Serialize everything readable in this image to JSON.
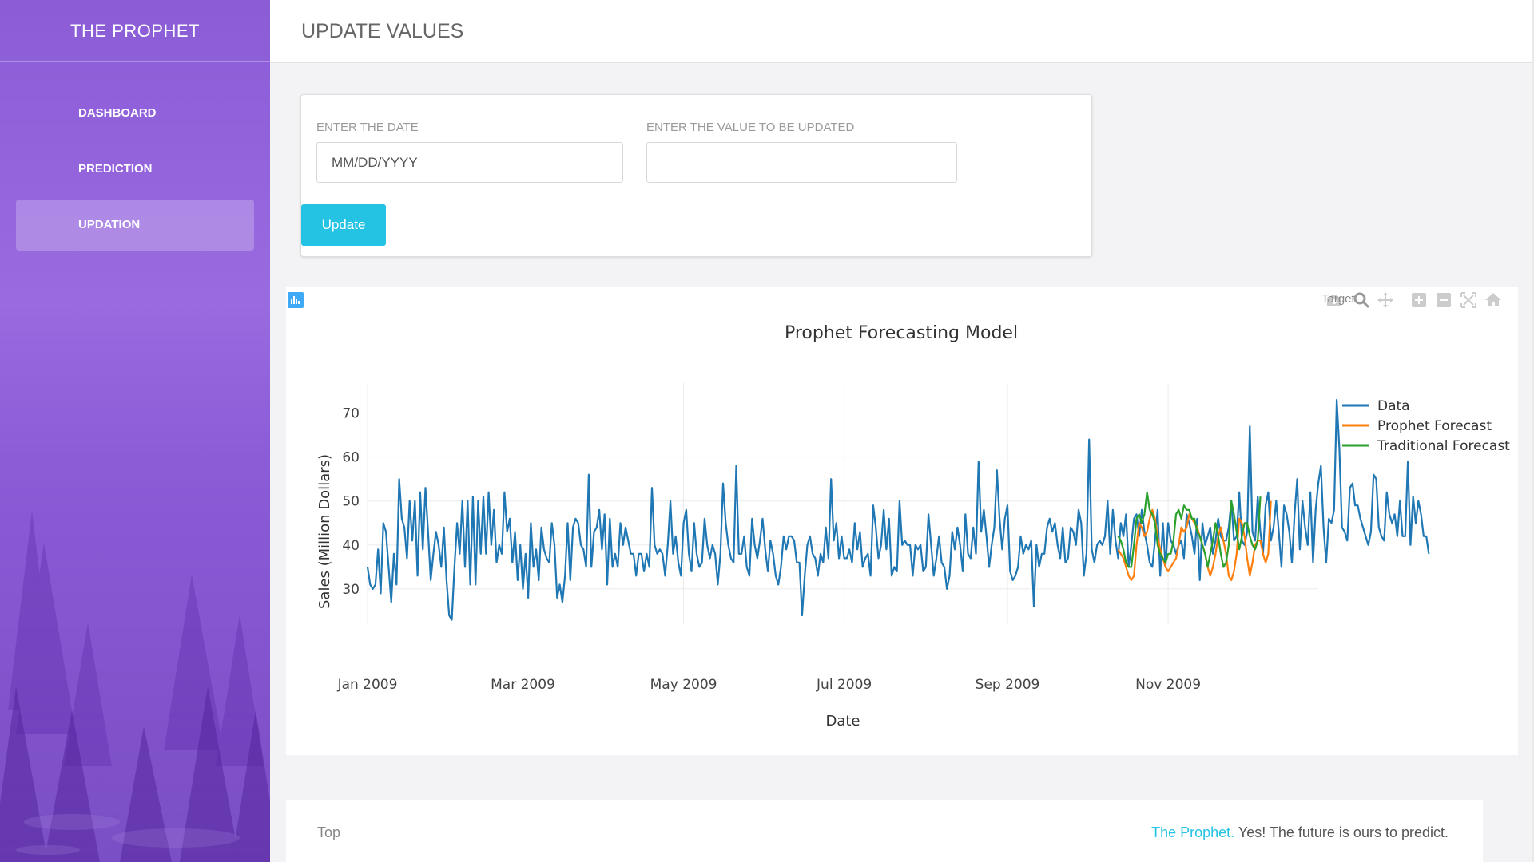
{
  "sidebar": {
    "brand": "THE PROPHET",
    "items": [
      {
        "label": "DASHBOARD",
        "active": false
      },
      {
        "label": "PREDICTION",
        "active": false
      },
      {
        "label": "UPDATION",
        "active": true
      }
    ]
  },
  "header": {
    "title": "UPDATE VALUES"
  },
  "form": {
    "date_label": "ENTER THE DATE",
    "date_placeholder": "MM/DD/YYYY",
    "value_label": "ENTER THE VALUE TO BE UPDATED",
    "value_value": "",
    "update_label": "Update"
  },
  "modebar": {
    "overlay_text": "Target",
    "icons": [
      "camera-icon",
      "zoom-icon",
      "pan-icon",
      "zoom-in-icon",
      "zoom-out-icon",
      "autoscale-icon",
      "home-icon",
      "spike-lines-icon",
      "hover-closest-icon",
      "hover-compare-icon",
      "plotly-logo-icon"
    ]
  },
  "chart_data": {
    "type": "line",
    "title": "Prophet Forecasting Model",
    "xlabel": "Date",
    "ylabel": "Sales (Million Dollars)",
    "x_ticks": [
      "Jan 2009",
      "Mar 2009",
      "May 2009",
      "Jul 2009",
      "Sep 2009",
      "Nov 2009"
    ],
    "x_tick_dates": [
      "2009-01-01",
      "2009-03-01",
      "2009-05-01",
      "2009-07-01",
      "2009-09-01",
      "2009-11-01"
    ],
    "y_ticks": [
      30,
      40,
      50,
      60,
      70
    ],
    "ylim": [
      22,
      75
    ],
    "xlim": [
      "2009-01-01",
      "2009-12-28"
    ],
    "grid": true,
    "legend_position": "top-right",
    "series": [
      {
        "name": "Data",
        "color": "#1f77b4",
        "start": "2009-01-01",
        "values": [
          35,
          31,
          30,
          31,
          39,
          29,
          45,
          43,
          35,
          27,
          38,
          31,
          55,
          46,
          44,
          37,
          50,
          41,
          50,
          33,
          52,
          39,
          53,
          43,
          32,
          38,
          43,
          40,
          35,
          44,
          32,
          24,
          23,
          35,
          45,
          38,
          50,
          35,
          50,
          31,
          51,
          31,
          50,
          38,
          51,
          38,
          52,
          40,
          48,
          36,
          40,
          38,
          52,
          43,
          46,
          36,
          43,
          32,
          40,
          30,
          38,
          28,
          45,
          35,
          39,
          32,
          44,
          39,
          37,
          36,
          45,
          40,
          28,
          31,
          27,
          33,
          45,
          32,
          44,
          46,
          45,
          40,
          39,
          35,
          56,
          35,
          43,
          44,
          48,
          39,
          47,
          31,
          46,
          35,
          38,
          35,
          45,
          40,
          44,
          41,
          38,
          38,
          33,
          38,
          38,
          34,
          38,
          35,
          53,
          40,
          38,
          39,
          38,
          33,
          40,
          50,
          38,
          42,
          36,
          33,
          45,
          48,
          38,
          34,
          45,
          38,
          35,
          36,
          46,
          40,
          37,
          40,
          38,
          31,
          38,
          54,
          45,
          40,
          37,
          36,
          58,
          38,
          38,
          42,
          35,
          33,
          46,
          40,
          37,
          41,
          46,
          39,
          34,
          41,
          38,
          33,
          31,
          35,
          42,
          39,
          42,
          42,
          41,
          36,
          36,
          24,
          33,
          40,
          42,
          38,
          37,
          33,
          38,
          36,
          44,
          37,
          55,
          41,
          45,
          37,
          42,
          37,
          37,
          39,
          36,
          45,
          39,
          43,
          35,
          37,
          38,
          33,
          49,
          44,
          37,
          40,
          48,
          39,
          46,
          33,
          35,
          34,
          50,
          40,
          41,
          40,
          40,
          33,
          40,
          39,
          40,
          34,
          35,
          47,
          40,
          33,
          37,
          42,
          36,
          35,
          30,
          33,
          43,
          39,
          44,
          40,
          34,
          47,
          38,
          37,
          44,
          38,
          59,
          43,
          48,
          42,
          35,
          40,
          44,
          57,
          46,
          39,
          46,
          49,
          34,
          32,
          33,
          35,
          42,
          38,
          40,
          39,
          41,
          26,
          40,
          35,
          38,
          38,
          44,
          46,
          43,
          45,
          40,
          37,
          44,
          36,
          37,
          44,
          43,
          40,
          48,
          45,
          33,
          38,
          64,
          39,
          36,
          40,
          41,
          40,
          42,
          50,
          38,
          48,
          41,
          37,
          45,
          42,
          47,
          35,
          40,
          46,
          47,
          42,
          48,
          43,
          40,
          36,
          35,
          41,
          48,
          33,
          45,
          35,
          45,
          41,
          40,
          38,
          40,
          41,
          37,
          47,
          45,
          42,
          38,
          46,
          32,
          45,
          40,
          42,
          44,
          38,
          41,
          46,
          42,
          41,
          41,
          44,
          50,
          41,
          42,
          52,
          41,
          40,
          43,
          67,
          43,
          41,
          51,
          43,
          38,
          49,
          52,
          41,
          44,
          50,
          43,
          35,
          49,
          47,
          43,
          36,
          47,
          55,
          39,
          50,
          44,
          40,
          52,
          36,
          48,
          54,
          58,
          44,
          36,
          46,
          45,
          48,
          73,
          62,
          44,
          43,
          41,
          53,
          54,
          49,
          49,
          46,
          44,
          42,
          40,
          43,
          56,
          55,
          44,
          42,
          41,
          52,
          47,
          45,
          47,
          42,
          50,
          42,
          42,
          59,
          40,
          51,
          45,
          50,
          47,
          42,
          42,
          38
        ]
      },
      {
        "name": "Prophet Forecast",
        "color": "#ff7f0e",
        "start": "2009-10-13",
        "values": [
          39,
          38,
          37,
          35,
          33,
          32,
          33,
          40,
          45,
          44,
          42,
          43,
          46,
          48,
          46,
          42,
          39,
          37,
          35,
          34,
          35,
          36,
          37,
          40,
          44,
          43,
          44,
          47,
          46,
          45,
          44,
          42,
          40,
          38,
          35,
          33,
          35,
          38,
          42,
          44,
          41,
          38,
          33,
          32,
          34,
          38,
          46,
          45,
          42,
          37,
          33,
          36,
          40,
          41,
          41,
          38,
          36,
          38,
          50
        ]
      },
      {
        "name": "Traditional Forecast",
        "color": "#2ca02c",
        "start": "2009-10-13",
        "values": [
          42,
          41,
          39,
          36,
          35,
          35,
          40,
          46,
          47,
          45,
          47,
          52,
          48,
          47,
          45,
          40,
          38,
          37,
          36,
          38,
          38,
          41,
          47,
          48,
          46,
          49,
          48,
          48,
          46,
          46,
          43,
          42,
          40,
          38,
          35,
          38,
          41,
          45,
          42,
          38,
          35,
          36,
          40,
          50,
          47,
          43,
          39,
          42,
          45,
          45,
          42,
          40,
          39,
          41,
          51
        ]
      }
    ]
  },
  "footer": {
    "top_link": "Top",
    "brand": "The Prophet.",
    "tagline": " Yes! The future is ours to predict."
  }
}
